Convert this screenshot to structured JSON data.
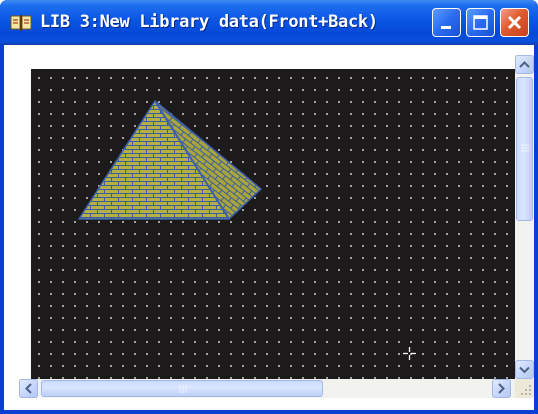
{
  "window": {
    "title": "LIB 3:New Library data(Front+Back)",
    "icon": "library-book-icon",
    "controls": {
      "minimize": "minimize-icon",
      "maximize": "maximize-icon",
      "close": "close-icon"
    }
  },
  "canvas": {
    "background": "#1c1a1a",
    "grid_dot_color": "#c8c8c8",
    "shape": {
      "type": "pyramid",
      "fill": "#b5b043",
      "mortar_color": "#3a5f9a",
      "outline": "#3c5fb0"
    },
    "cursor": "crosshair-cursor"
  },
  "scrollbars": {
    "vertical": {
      "up": "arrow-up-icon",
      "down": "arrow-down-icon"
    },
    "horizontal": {
      "left": "arrow-left-icon",
      "right": "arrow-right-icon"
    }
  },
  "colors": {
    "titlebar": "#0a55e3",
    "close_button": "#e05a30",
    "scrollbar_face": "#c5d6fc"
  }
}
